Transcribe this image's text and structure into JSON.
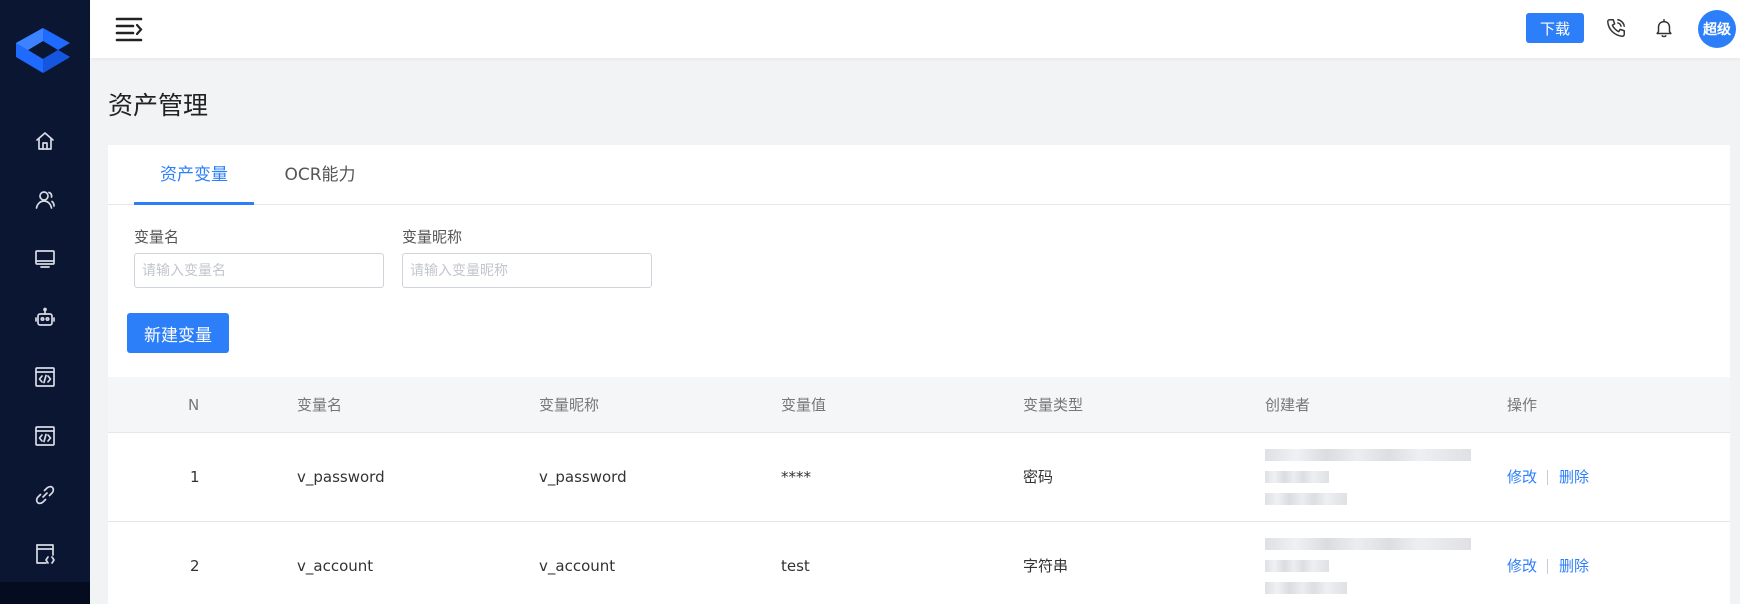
{
  "header": {
    "download_label": "下载",
    "avatar_text": "超级"
  },
  "page": {
    "title": "资产管理"
  },
  "tabs": [
    {
      "label": "资产变量",
      "active": true
    },
    {
      "label": "OCR能力",
      "active": false
    }
  ],
  "filters": {
    "name_label": "变量名",
    "name_placeholder": "请输入变量名",
    "nickname_label": "变量昵称",
    "nickname_placeholder": "请输入变量昵称"
  },
  "create_button": "新建变量",
  "table": {
    "columns": [
      "N",
      "变量名",
      "变量昵称",
      "变量值",
      "变量类型",
      "创建者",
      "操作"
    ],
    "rows": [
      {
        "n": "1",
        "name": "v_password",
        "nickname": "v_password",
        "value": "****",
        "type": "密码",
        "actions": [
          "修改",
          "删除"
        ]
      },
      {
        "n": "2",
        "name": "v_account",
        "nickname": "v_account",
        "value": "test",
        "type": "字符串",
        "actions": [
          "修改",
          "删除"
        ]
      }
    ]
  },
  "colors": {
    "accent": "#2d7ff9",
    "sidebar": "#0b1633"
  },
  "icons": {
    "sidebar": [
      "home-icon",
      "users-icon",
      "monitor-icon",
      "robot-icon",
      "code-window-icon",
      "code-window-icon",
      "link-icon",
      "code-doc-icon"
    ],
    "header": [
      "menu-toggle-icon",
      "phone-icon",
      "bell-icon"
    ]
  }
}
